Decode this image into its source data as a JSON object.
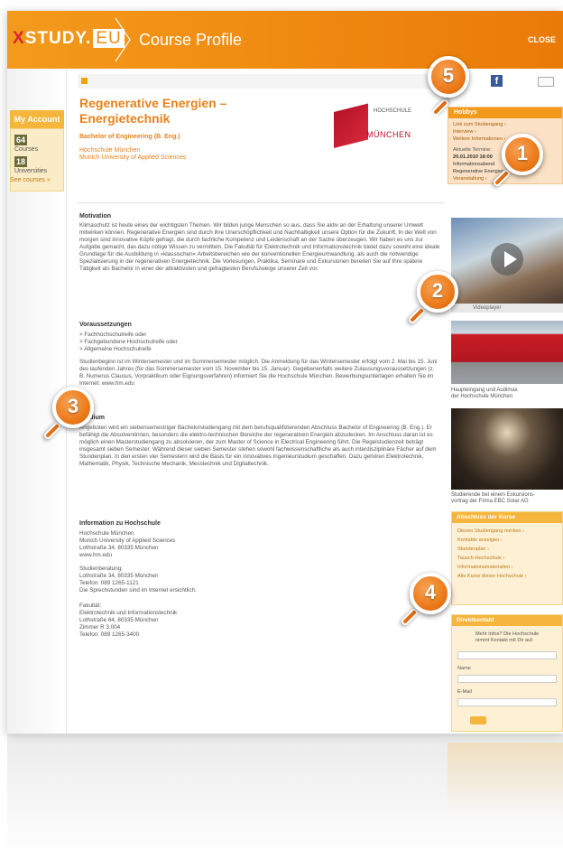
{
  "header": {
    "logo_main": "STUDY.",
    "logo_x": "X",
    "logo_eu": "EU",
    "section_title": "Course Profile",
    "close_label": "CLOSE"
  },
  "left_sidebar": {
    "my_account_label": "My Account",
    "stat_courses": {
      "count": "64",
      "label": "Courses"
    },
    "stat_universities": {
      "count": "18",
      "label": "Universities"
    },
    "see_more_label": "See courses »"
  },
  "course": {
    "title_line1": "Regenerative Energien –",
    "title_line2": "Energietechnik",
    "degree": "Bachelor of Engineering (B. Eng.)",
    "university_de": "Hochschule München",
    "university_en": "Munich University of Applied Sciences",
    "logo_name": "HOCHSCHULE",
    "logo_city": "MÜNCHEN"
  },
  "sections": {
    "motivation_heading": "Motivation",
    "motivation_text": "Klimaschutz ist heute eines der wichtigsten Themen. Wir bilden junge Menschen so aus, dass Sie aktiv an der Erhaltung unserer Umwelt mitwirken können. Regenerative Energien sind durch ihre Unerschöpflichkeit und Nachhaltigkeit unsere Option für die Zukunft. In der Welt von morgen sind innovative Köpfe gefragt, die durch fachliche Kompetenz und Leidenschaft an der Sache überzeugen. Wir haben es uns zur Aufgabe gemacht, das dazu nötige Wissen zu vermitteln. Die Fakultät für Elektrotechnik und Informationstechnik bietet dazu sowohl eine ideale Grundlage für die Ausbildung in »klassischen« Arbeitsbereichen wie der konventionellen Energieumwandlung, als auch die notwendige Spezialisierung in der regenerativen Energietechnik. Die Vorlesungen, Praktika, Seminare und Exkursionen bereiten Sie auf Ihre spätere Tätigkeit als Bachelor in einer der attraktivsten und gefragtesten Berufszweige unserer Zeit vor.",
    "requirements_heading": "Voraussetzungen",
    "requirements_list": "> Fachhochschulreife oder\n> Fachgebundene Hochschulreife oder\n> Allgemeine Hochschulreife",
    "requirements_text": "Studienbeginn ist im Wintersemester und im Sommersemester möglich. Die Anmeldung für das Wintersemester erfolgt vom 2. Mai bis 15. Juni des laufenden Jahres (für das Sommersemester vom 15. November bis 15. Januar). Gegebenenfalls weitere Zulassungsvoraussetzungen (z. B. Numerus Clausus, Vorpraktikum oder Eignungsverfahren) informiert Sie die Hochschule München. Bewerbungsunterlagen erhalten Sie im Internet: www.hm.edu",
    "study_heading": "Studium",
    "study_text": "Angeboten wird ein siebensemestriger Bachelorstudiengang mit dem berufsqualifizierenden Abschluss Bachelor of Engineering (B. Eng.). Er befähigt die Absolventinnen, besonders die elektro-technischen Bereiche der regenerativen Energien abzudecken. Im Anschluss daran ist es möglich einen Masterstudiengang zu absolvieren, der zum Master of Science in Electrical Engineering führt. Die Regelstudienzeit beträgt insgesamt sieben Semester. Während dieser sieben Semester stehen sowohl fachwissenschaftliche als auch interdisziplinäre Fächer auf dem Stundenplan. In den ersten vier Semestern wird die Basis für ein innovatives Ingenieurstudium geschaffen. Dazu gehören Elektrotechnik, Mathematik, Physik, Technische Mechanik, Messtechnik und Digitaltechnik.",
    "info_heading": "Information zu Hochschule",
    "info_address": "Hochschule München\nMunich University of Applied Sciences\nLothstraße 34, 80335 München\nwww.hm.edu",
    "info_advice": "Studienberatung:\nLothstraße 34, 80335 München\nTelefon: 089 1265-1121\nDie Sprechstunden sind im Internet ersichtlich.",
    "info_faculty": "Fakultät:\nElektrotechnik und Informationstechnik\nLothstraße 64, 80335 München\nZimmer R 3.004\nTelefon: 089 1265-3400"
  },
  "right_column": {
    "news_title": "Hobbys",
    "news_lines": [
      "Link zum Studiengang ›",
      "Interview ›",
      "Weitere Informationen ›",
      "Aktuelle Termine:",
      "20.01.2010 18:00",
      "Informationsabend",
      "Regenerative Energien",
      "Veranstaltung ›"
    ],
    "video_label": "Videoplayer",
    "photo1_caption": "Haupteingang und Audimax\nder Hochschule München",
    "photo2_caption": "Studierende bei einem Exkursions-\nvortrag der Firma EBC Solar AG",
    "advisor_title": "Abschluss der Kurse",
    "advisor_lines": [
      "Diesen Studiengang merken ›",
      "Kontakte anzeigen ›",
      "Stundenplan ›",
      "Tausch-Hochschule ›",
      "Informationsmaterialien ›",
      "Alle Kurse dieser Hochschule ›"
    ],
    "contact_title": "Direktkontakt",
    "contact_text": "Mehr Infos? Die Hochschule\nnimmt Kontakt mit Dir auf.",
    "contact_name_label": "Name",
    "contact_email_label": "E-Mail"
  },
  "callouts": [
    "1",
    "2",
    "3",
    "4",
    "5"
  ],
  "colors": {
    "header_orange": "#f08c12",
    "title_orange": "#e8821a",
    "callout_orange": "#ec7a1a",
    "hm_red": "#b51226"
  }
}
